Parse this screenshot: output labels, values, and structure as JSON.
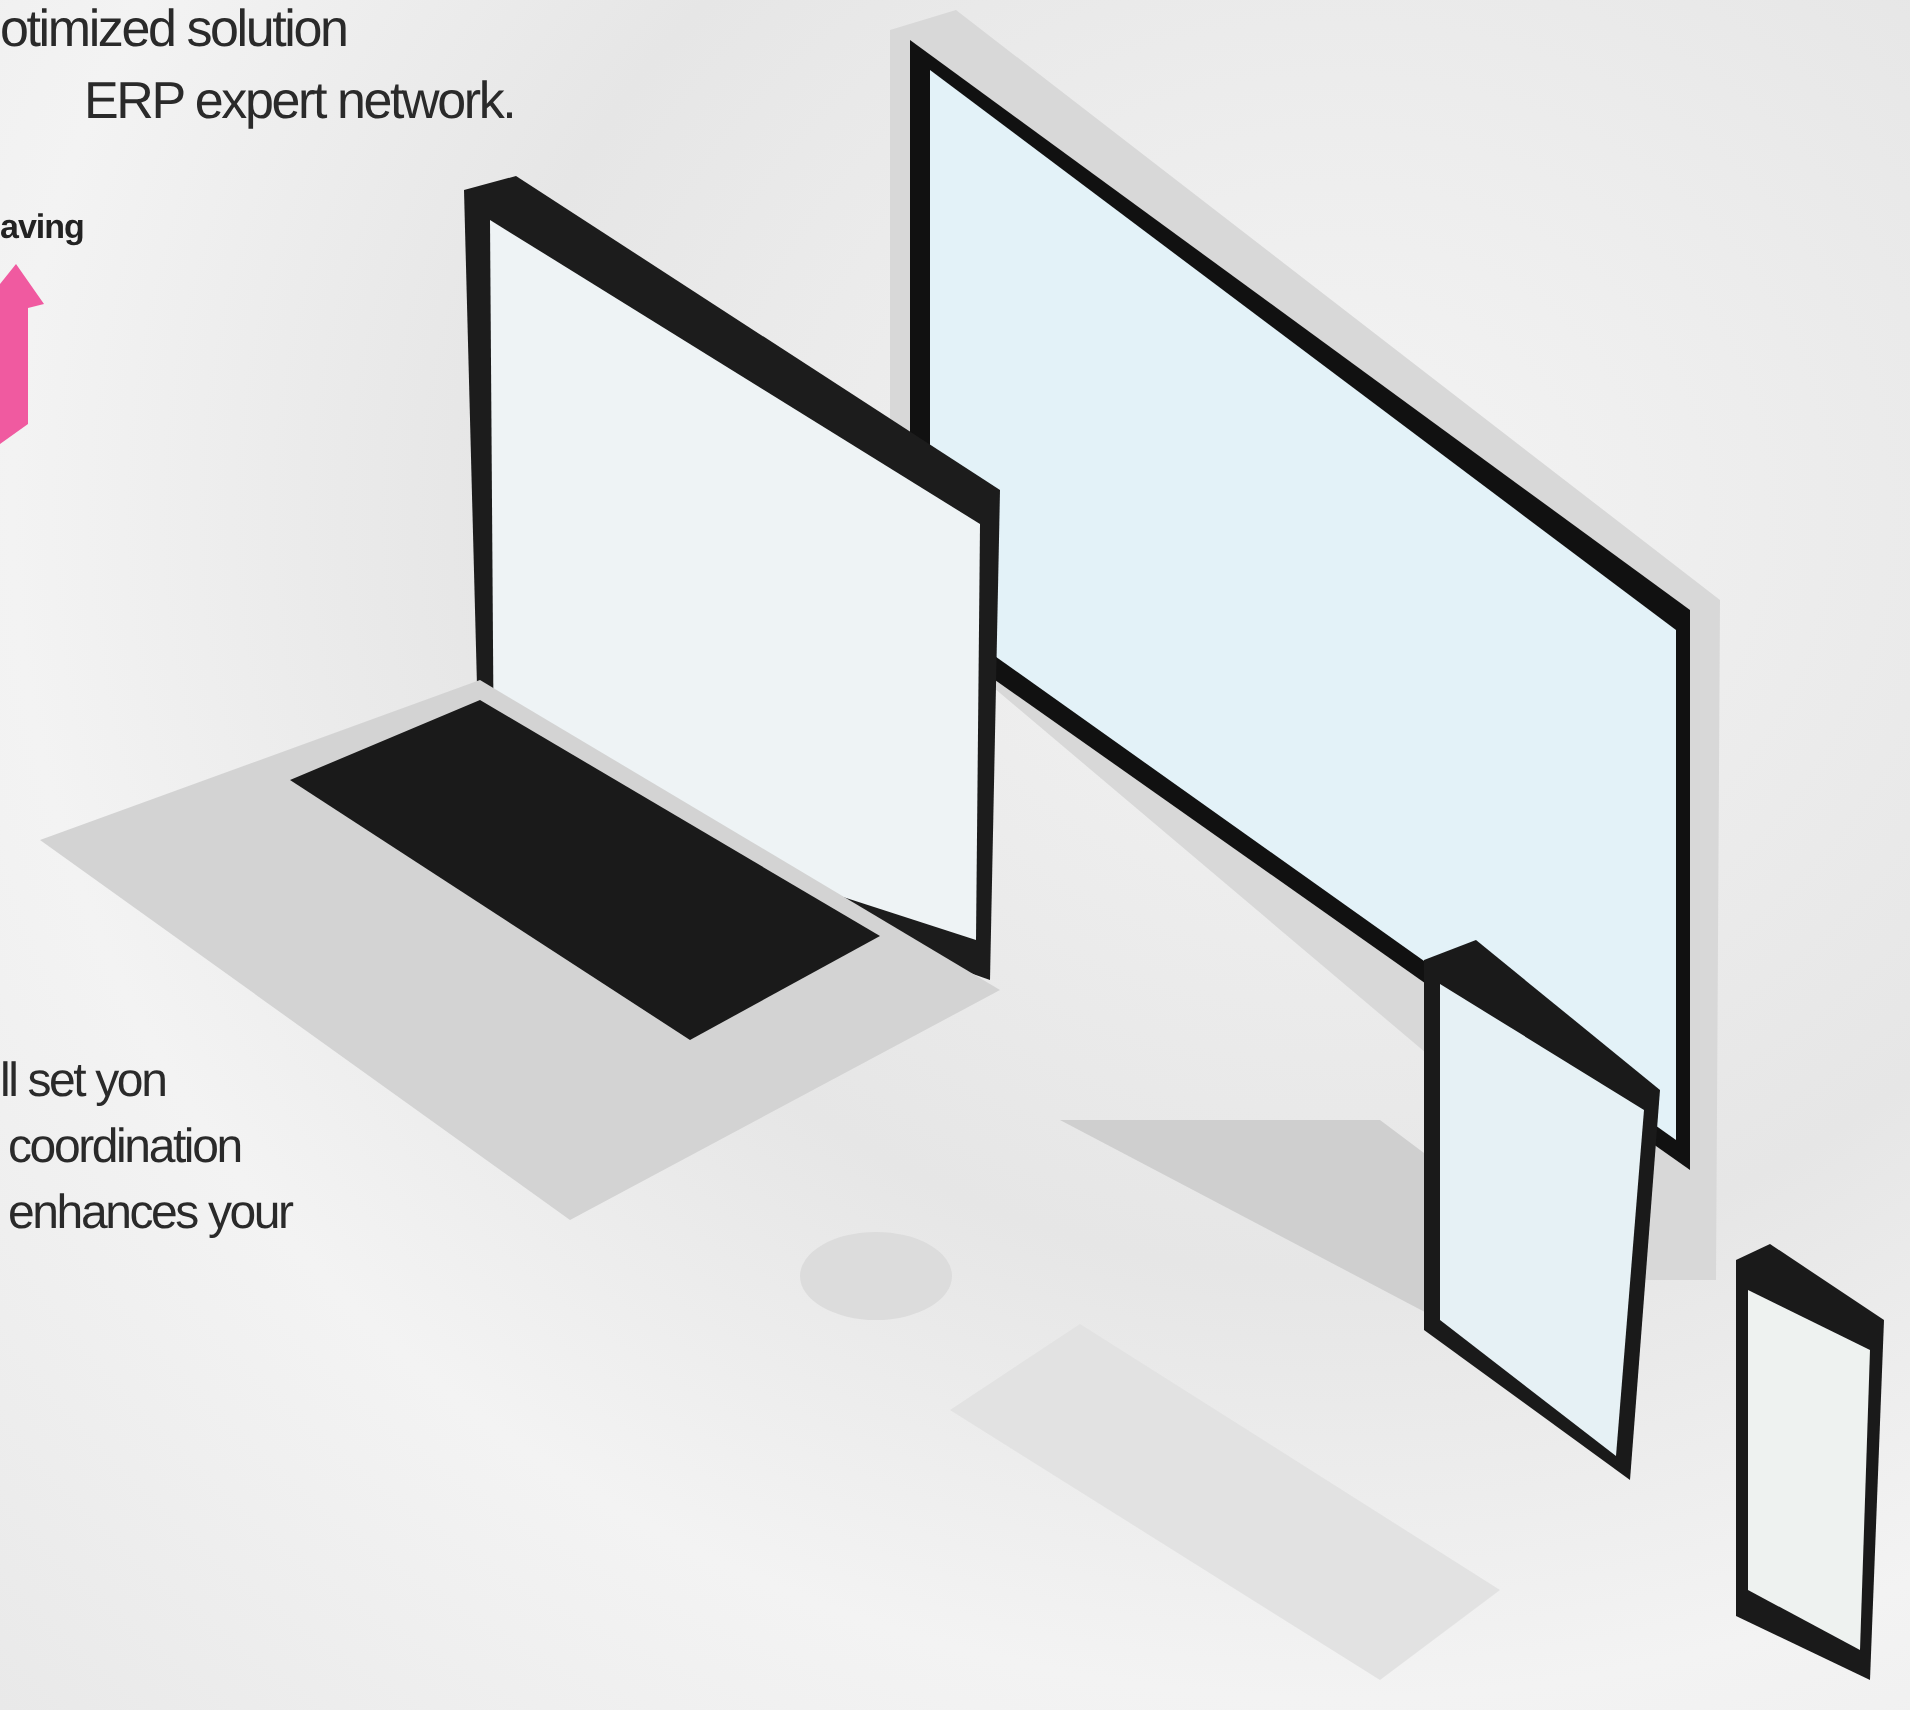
{
  "intro": {
    "lines": [
      "otimized solution",
      "ERP expert network."
    ]
  },
  "highlight": {
    "label": "aving"
  },
  "body": {
    "lines": [
      "ll set yon",
      "coordination",
      "enhances your"
    ]
  }
}
